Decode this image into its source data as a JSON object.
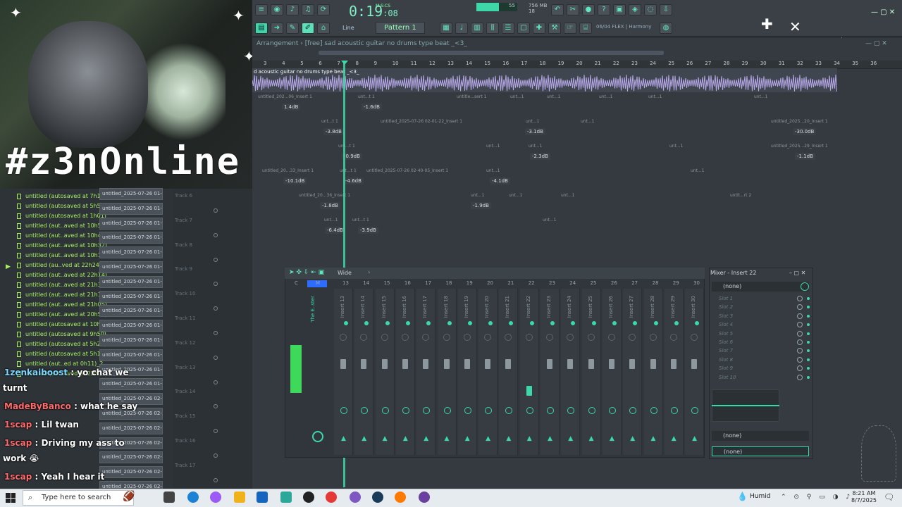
{
  "stream": {
    "channel_logo": "#z3nOnline",
    "chat": [
      {
        "user": "1zenkaiboost",
        "message": "yo chat we",
        "message_cont": "turnt",
        "color": "#7ad7ff"
      },
      {
        "user": "MadeByBanco",
        "message": "what he say",
        "color": "#ff6b6b"
      },
      {
        "user": "1scap",
        "message": "Lil twan",
        "color": "#ff6b6b"
      },
      {
        "user": "1scap",
        "message": "Driving my ass to",
        "message_cont": "work 😭",
        "color": "#ff6b6b"
      },
      {
        "user": "1scap",
        "message": "Yeah I hear it",
        "color": "#ff6b6b"
      }
    ]
  },
  "toolbar": {
    "time_main": "0:19",
    "time_sub": ":08",
    "time_units": "M:S:CS",
    "cpu_value": "55",
    "memory": "756 MB",
    "memory_sub": "18",
    "cpu_fraction": 0.55,
    "snap_mode": "Line",
    "pattern": "Pattern 1",
    "plugin_info": "06/04",
    "plugin_name": "FLEX | Harmony"
  },
  "playlist": {
    "breadcrumb": "Arrangement",
    "separator": "›",
    "project_title": "[free] sad acoustic guitar no drums type beat _<3_",
    "audio_clip_title": "d acoustic guitar no drums type beat _<3_",
    "ruler": [
      "3",
      "4",
      "5",
      "6",
      "7",
      "8",
      "9",
      "10",
      "11",
      "12",
      "13",
      "14",
      "15",
      "16",
      "17",
      "18",
      "19",
      "20",
      "21",
      "22",
      "23",
      "24",
      "25",
      "26",
      "27",
      "28",
      "29",
      "30",
      "31",
      "32",
      "33",
      "34",
      "35",
      "36"
    ],
    "db_labels": [
      "1.4dB",
      "-1.6dB",
      "-3.8dB",
      "-3.1dB",
      "-30.0dB",
      "-0.9dB",
      "-2.3dB",
      "-1.1dB",
      "-10.1dB",
      "-4.6dB",
      "-4.1dB",
      "-1.8dB",
      "-1.9dB",
      "-6.4dB",
      "-3.9dB"
    ],
    "clip_names": [
      "untitled_202...06_Insert 1",
      "unt...t 1",
      "untitle...sert 1",
      "unt...1",
      "unt...1",
      "unt...1",
      "unt...1",
      "unt...1",
      "untitled_2025-07-26 02-01-22_Insert 1",
      "unt...t 1",
      "unt...1",
      "unt...1",
      "untitled_2025...20_Insert 1",
      "unt...t 1",
      "unt...1",
      "unt...1",
      "unt...1",
      "untitled_2025...29_Insert 1",
      "untitled_20...33_Insert 1",
      "unt...t 1",
      "untitled_2025-07-26 02-40-05_Insert 1",
      "unt...1",
      "unt...1",
      "untitled_20...36_Insert 1",
      "unt...1",
      "unt...1",
      "unt...1",
      "untit...rt 2",
      "unt...1",
      "unt...t 1",
      "unt...1"
    ],
    "tracks": [
      "Track 6",
      "Track 7",
      "Track 8",
      "Track 9",
      "Track 10",
      "Track 11",
      "Track 12",
      "Track 13",
      "Track 14",
      "Track 15",
      "Track 16",
      "Track 17"
    ]
  },
  "browser": {
    "autosaves": [
      "untitled (autosaved at 7h13)",
      "untitled (autosaved at 5h52)",
      "untitled (autosaved at 1h01)",
      "untitled (aut..aved at 10h52)",
      "untitled (aut..aved at 10h42)",
      "untitled (aut..aved at 10h32)",
      "untitled (aut..aved at 10h18)",
      "untitled (au..ved at 22h24)",
      "untitled (aut..aved at 22h14)",
      "untitled (aut..aved at 21h33)",
      "untitled (aut..aved at 21h16)",
      "untitled (aut..aved at 21h05)",
      "untitled (aut..aved at 20h54)",
      "untitled (autosaved at 10h00)",
      "untitled (autosaved at 9h50)",
      "untitled (autosaved at 5h21)",
      "untitled (autosaved at 5h11)",
      "untitled (aut..ed at 0h11)_2",
      "untitled (aut..aved at 22h48)"
    ],
    "files": [
      "untitled_2025-07-26 01-",
      "untitled_2025-07-26 01-",
      "untitled_2025-07-26 01-",
      "untitled_2025-07-26 01-",
      "untitled_2025-07-26 01-",
      "untitled_2025-07-26 01-",
      "untitled_2025-07-26 01-",
      "untitled_2025-07-26 01-",
      "untitled_2025-07-26 01-",
      "untitled_2025-07-26 01-",
      "untitled_2025-07-26 01-",
      "untitled_2025-07-26 01-",
      "untitled_2025-07-26 01-",
      "untitled_2025-07-26 01-",
      "untitled_2025-07-26 02-",
      "untitled_2025-07-26 02-",
      "untitled_2025-07-26 02-",
      "untitled_2025-07-26 02-",
      "untitled_2025-07-26 02-",
      "untitled_2025-07-26 02-",
      "untitled_2025-07-26 02-"
    ]
  },
  "mixer": {
    "title": "Wide",
    "master_label": "M",
    "master_name": "The E..ster",
    "strips": [
      "Insert 13",
      "Insert 14",
      "Insert 15",
      "Insert 16",
      "Insert 17",
      "Insert 18",
      "Insert 19",
      "Insert 20",
      "Insert 21",
      "Insert 22",
      "Insert 23",
      "Insert 24",
      "Insert 25",
      "Insert 26",
      "Insert 27",
      "Insert 28",
      "Insert 29",
      "Insert 30"
    ],
    "numbers": [
      "C",
      "M",
      "13",
      "14",
      "15",
      "16",
      "17",
      "18",
      "19",
      "20",
      "21",
      "22",
      "23",
      "24",
      "25",
      "26",
      "27",
      "28",
      "29",
      "30"
    ],
    "insert_panel": {
      "title": "Mixer - Insert 22",
      "preset": "(none)",
      "slots": [
        "Slot 1",
        "Slot 2",
        "Slot 3",
        "Slot 4",
        "Slot 5",
        "Slot 6",
        "Slot 7",
        "Slot 8",
        "Slot 9",
        "Slot 10"
      ],
      "in_route": "(none)",
      "out_route": "(none)"
    }
  },
  "taskbar": {
    "search_placeholder": "Type here to search",
    "weather": "Humid",
    "time": "8:21 AM",
    "date": "8/7/2025"
  }
}
